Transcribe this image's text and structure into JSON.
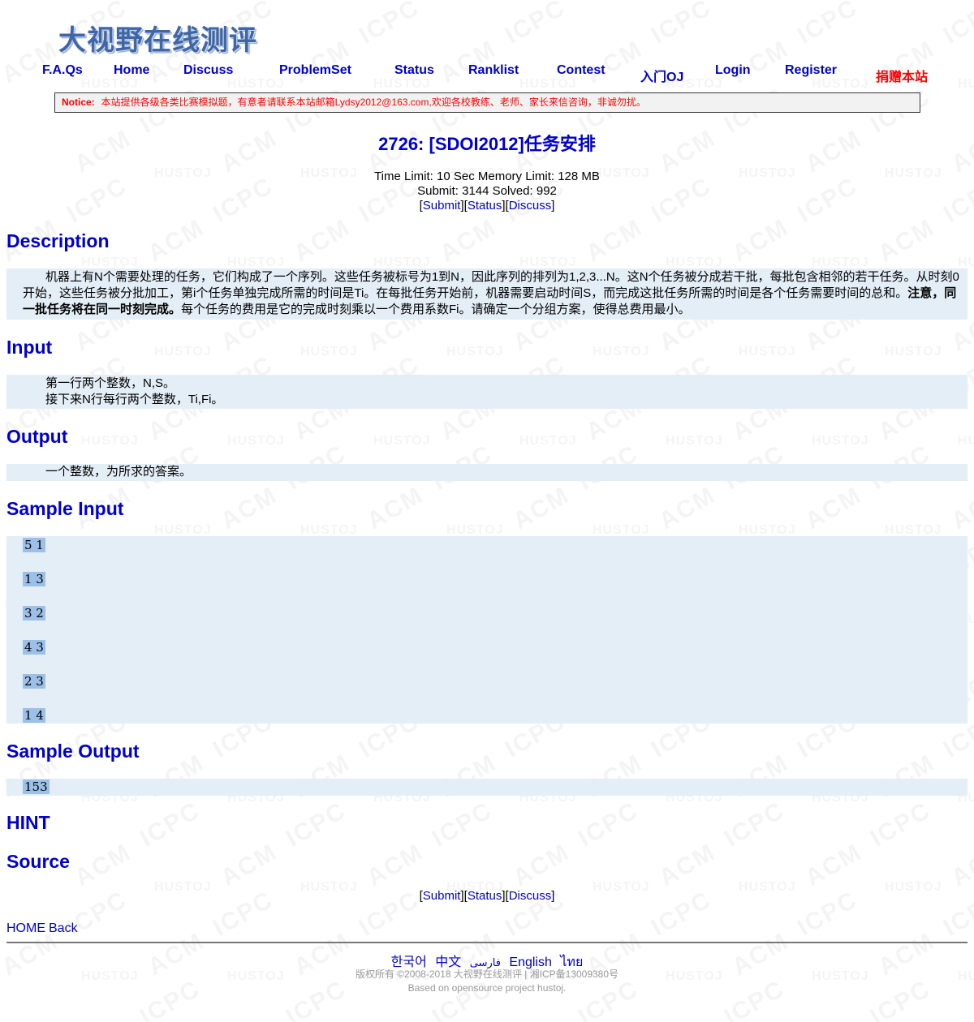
{
  "logo": "大视野在线测评",
  "nav": {
    "faq": "F.A.Qs",
    "home": "Home",
    "discuss": "Discuss",
    "problemset": "ProblemSet",
    "status": "Status",
    "ranklist": "Ranklist",
    "contest": "Contest",
    "intro_oj": "入门OJ",
    "login": "Login",
    "register": "Register",
    "donate": "捐赠本站"
  },
  "notice": {
    "label": "Notice:",
    "text": "本站提供各级各类比赛模拟题，有意者请联系本站邮箱Lydsy2012@163.com,欢迎各校教练、老师、家长来信咨询，非诚勿扰。"
  },
  "problem": {
    "title": "2726: [SDOI2012]任务安排",
    "limits": "Time Limit: 10 Sec  Memory Limit: 128 MB",
    "stats": "Submit: 3144  Solved: 992",
    "submit": "Submit",
    "status": "Status",
    "discuss": "Discuss"
  },
  "sections": {
    "description": "Description",
    "input": "Input",
    "output": "Output",
    "sample_input": "Sample Input",
    "sample_output": "Sample Output",
    "hint": "HINT",
    "source": "Source"
  },
  "description": {
    "part1": "机器上有N个需要处理的任务，它们构成了一个序列。这些任务被标号为1到N，因此序列的排列为1,2,3...N。这N个任务被分成若干批，每批包含相邻的若干任务。从时刻0开始，这些任务被分批加工，第i个任务单独完成所需的时间是Ti。在每批任务开始前，机器需要启动时间S，而完成这批任务所需的时间是各个任务需要时间的总和。",
    "bold": "注意，同一批任务将在同一时刻完成。",
    "part2": "每个任务的费用是它的完成时刻乘以一个费用系数Fi。请确定一个分组方案，使得总费用最小。"
  },
  "input_text": {
    "line1": "第一行两个整数，N,S。",
    "line2": "接下来N行每行两个整数，Ti,Fi。"
  },
  "output_text": "一个整数，为所求的答案。",
  "sample_input_lines": [
    "5 1",
    "1 3",
    "3 2",
    "4 3",
    "2 3",
    "1 4"
  ],
  "sample_output": "153",
  "bottom": {
    "submit": "Submit",
    "status": "Status",
    "discuss": "Discuss",
    "home": "HOME",
    "back": "Back"
  },
  "languages": [
    "한국어",
    "中文",
    "فارسی",
    "English",
    "ไทย"
  ],
  "footer": {
    "copyright": "版权所有 ©2008-2018 大视野在线测评 | 湘ICP备13009380号",
    "based_on": "Based on opensource project hustoj."
  },
  "watermark": {
    "words": [
      "ACM",
      "ICPC",
      "HUSTOJ"
    ]
  },
  "colors": {
    "link": "#0000cc",
    "notice": "#ff0000",
    "section_bg": "#e4eef7",
    "selection": "#9cc0e8"
  }
}
